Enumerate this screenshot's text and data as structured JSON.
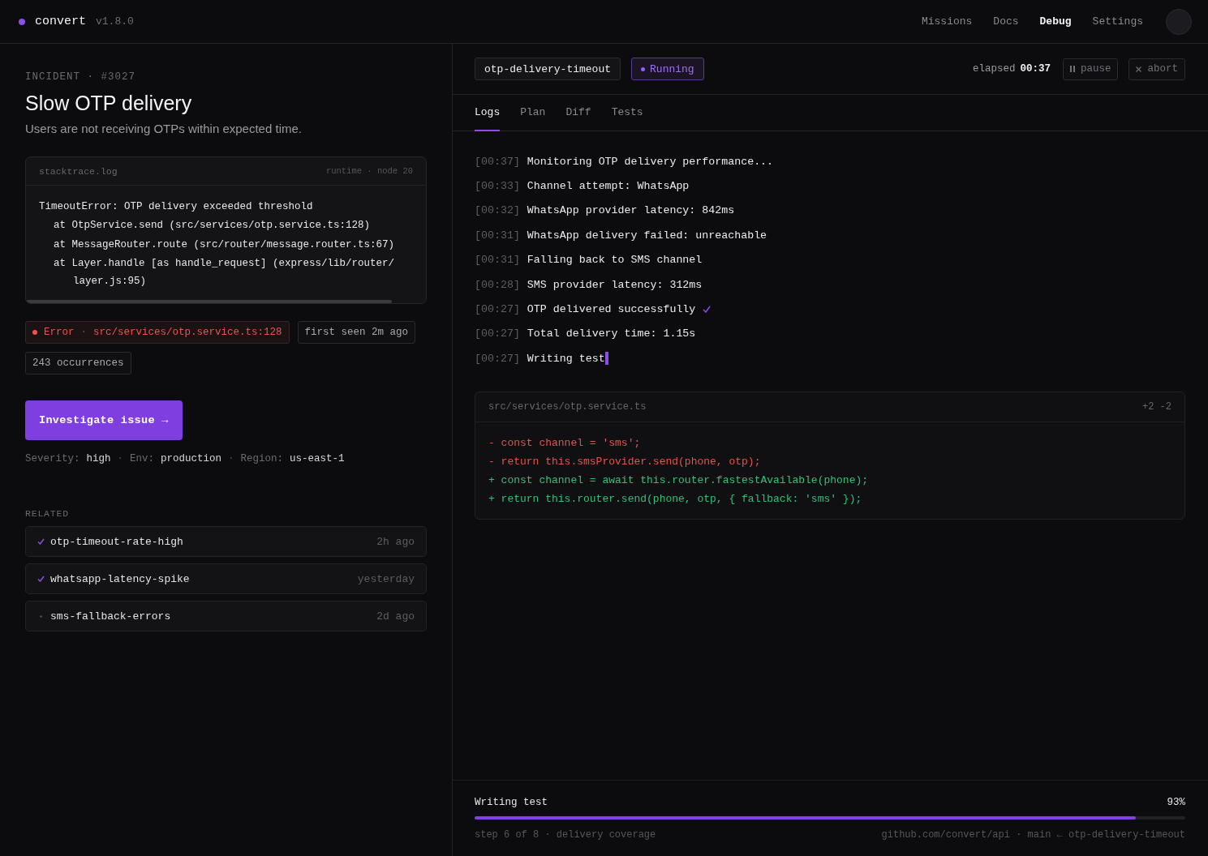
{
  "app": {
    "name": "convert",
    "version": "v1.8.0"
  },
  "nav": [
    {
      "label": "Missions",
      "selected": false
    },
    {
      "label": "Docs",
      "selected": false
    },
    {
      "label": "Debug",
      "selected": true
    },
    {
      "label": "Settings",
      "selected": false
    }
  ],
  "incident": {
    "eyebrow": "INCIDENT · #3027",
    "title": "Slow OTP delivery",
    "description": "Users are not receiving OTPs within expected time.",
    "stacktrace": {
      "file": "stacktrace.log",
      "meta": "runtime · node 20",
      "lines": [
        {
          "kind": "head",
          "text": "TimeoutError: OTP delivery exceeded threshold"
        },
        {
          "kind": "frame",
          "text": "at OtpService.send (src/services/otp.service.ts:128)"
        },
        {
          "kind": "frame",
          "text": "at MessageRouter.route (src/router/message.router.ts:67)"
        },
        {
          "kind": "frame",
          "text": "at Layer.handle [as handle_request] (express/lib/router/"
        },
        {
          "kind": "continuation",
          "text": "layer.js:95)"
        }
      ]
    },
    "tags": [
      {
        "kind": "error",
        "label": "Error",
        "separator": "·",
        "detail": "src/services/otp.service.ts:128"
      },
      {
        "kind": "plain",
        "label": "first seen 2m ago"
      },
      {
        "kind": "plain",
        "label": "243 occurrences"
      }
    ],
    "action": "Investigate issue →",
    "meta": [
      {
        "label": "Severity:",
        "value": "high"
      },
      {
        "separator": "·",
        "label": "Env:",
        "value": "production"
      },
      {
        "separator": "·",
        "label": "Region:",
        "value": "us-east-1"
      }
    ],
    "related": {
      "title": "RELATED",
      "items": [
        {
          "name": "otp-timeout-rate-high",
          "time": "2h ago",
          "resolved": true
        },
        {
          "name": "whatsapp-latency-spike",
          "time": "yesterday",
          "resolved": true
        },
        {
          "name": "sms-fallback-errors",
          "time": "2d ago",
          "resolved": false
        }
      ]
    }
  },
  "run": {
    "task": "otp-delivery-timeout",
    "status": "Running",
    "elapsed_label": "elapsed",
    "elapsed": "00:37",
    "buttons": [
      {
        "kind": "pause",
        "label": "pause"
      },
      {
        "kind": "abort",
        "label": "abort"
      }
    ],
    "tabs": [
      {
        "label": "Logs",
        "selected": true
      },
      {
        "label": "Plan",
        "selected": false
      },
      {
        "label": "Diff",
        "selected": false
      },
      {
        "label": "Tests",
        "selected": false
      }
    ],
    "logs": [
      {
        "time": "[00:37]",
        "text": "Monitoring OTP delivery performance...",
        "kind": "plain"
      },
      {
        "time": "[00:33]",
        "text": "Channel attempt: WhatsApp",
        "kind": "plain"
      },
      {
        "time": "[00:32]",
        "text": "WhatsApp provider latency: 842ms",
        "kind": "plain"
      },
      {
        "time": "[00:31]",
        "text": "WhatsApp delivery failed: unreachable",
        "kind": "plain"
      },
      {
        "time": "[00:31]",
        "text": "Falling back to SMS channel",
        "kind": "plain"
      },
      {
        "time": "[00:28]",
        "text": "SMS provider latency: 312ms",
        "kind": "plain"
      },
      {
        "time": "[00:27]",
        "text": "OTP delivered successfully",
        "kind": "success"
      },
      {
        "time": "[00:27]",
        "text": "Total delivery time: 1.15s",
        "kind": "plain"
      },
      {
        "time": "[00:27]",
        "text": "Writing test",
        "kind": "cursor"
      }
    ],
    "diff": {
      "file": "src/services/otp.service.ts",
      "stats": "+2 -2",
      "lines": [
        {
          "kind": "removed",
          "text": "- const channel = 'sms';"
        },
        {
          "kind": "removed",
          "text": "- return this.smsProvider.send(phone, otp);"
        },
        {
          "kind": "added",
          "text": "+ const channel = await this.router.fastestAvailable(phone);"
        },
        {
          "kind": "added",
          "text": "+ return this.router.send(phone, otp, { fallback: 'sms' });"
        }
      ]
    },
    "progress": {
      "label": "Writing test",
      "percent": "93%",
      "level": 0.93,
      "step": "step 6 of 8 · delivery coverage",
      "repo": "github.com/convert/api · main ← otp-delivery-timeout"
    }
  }
}
